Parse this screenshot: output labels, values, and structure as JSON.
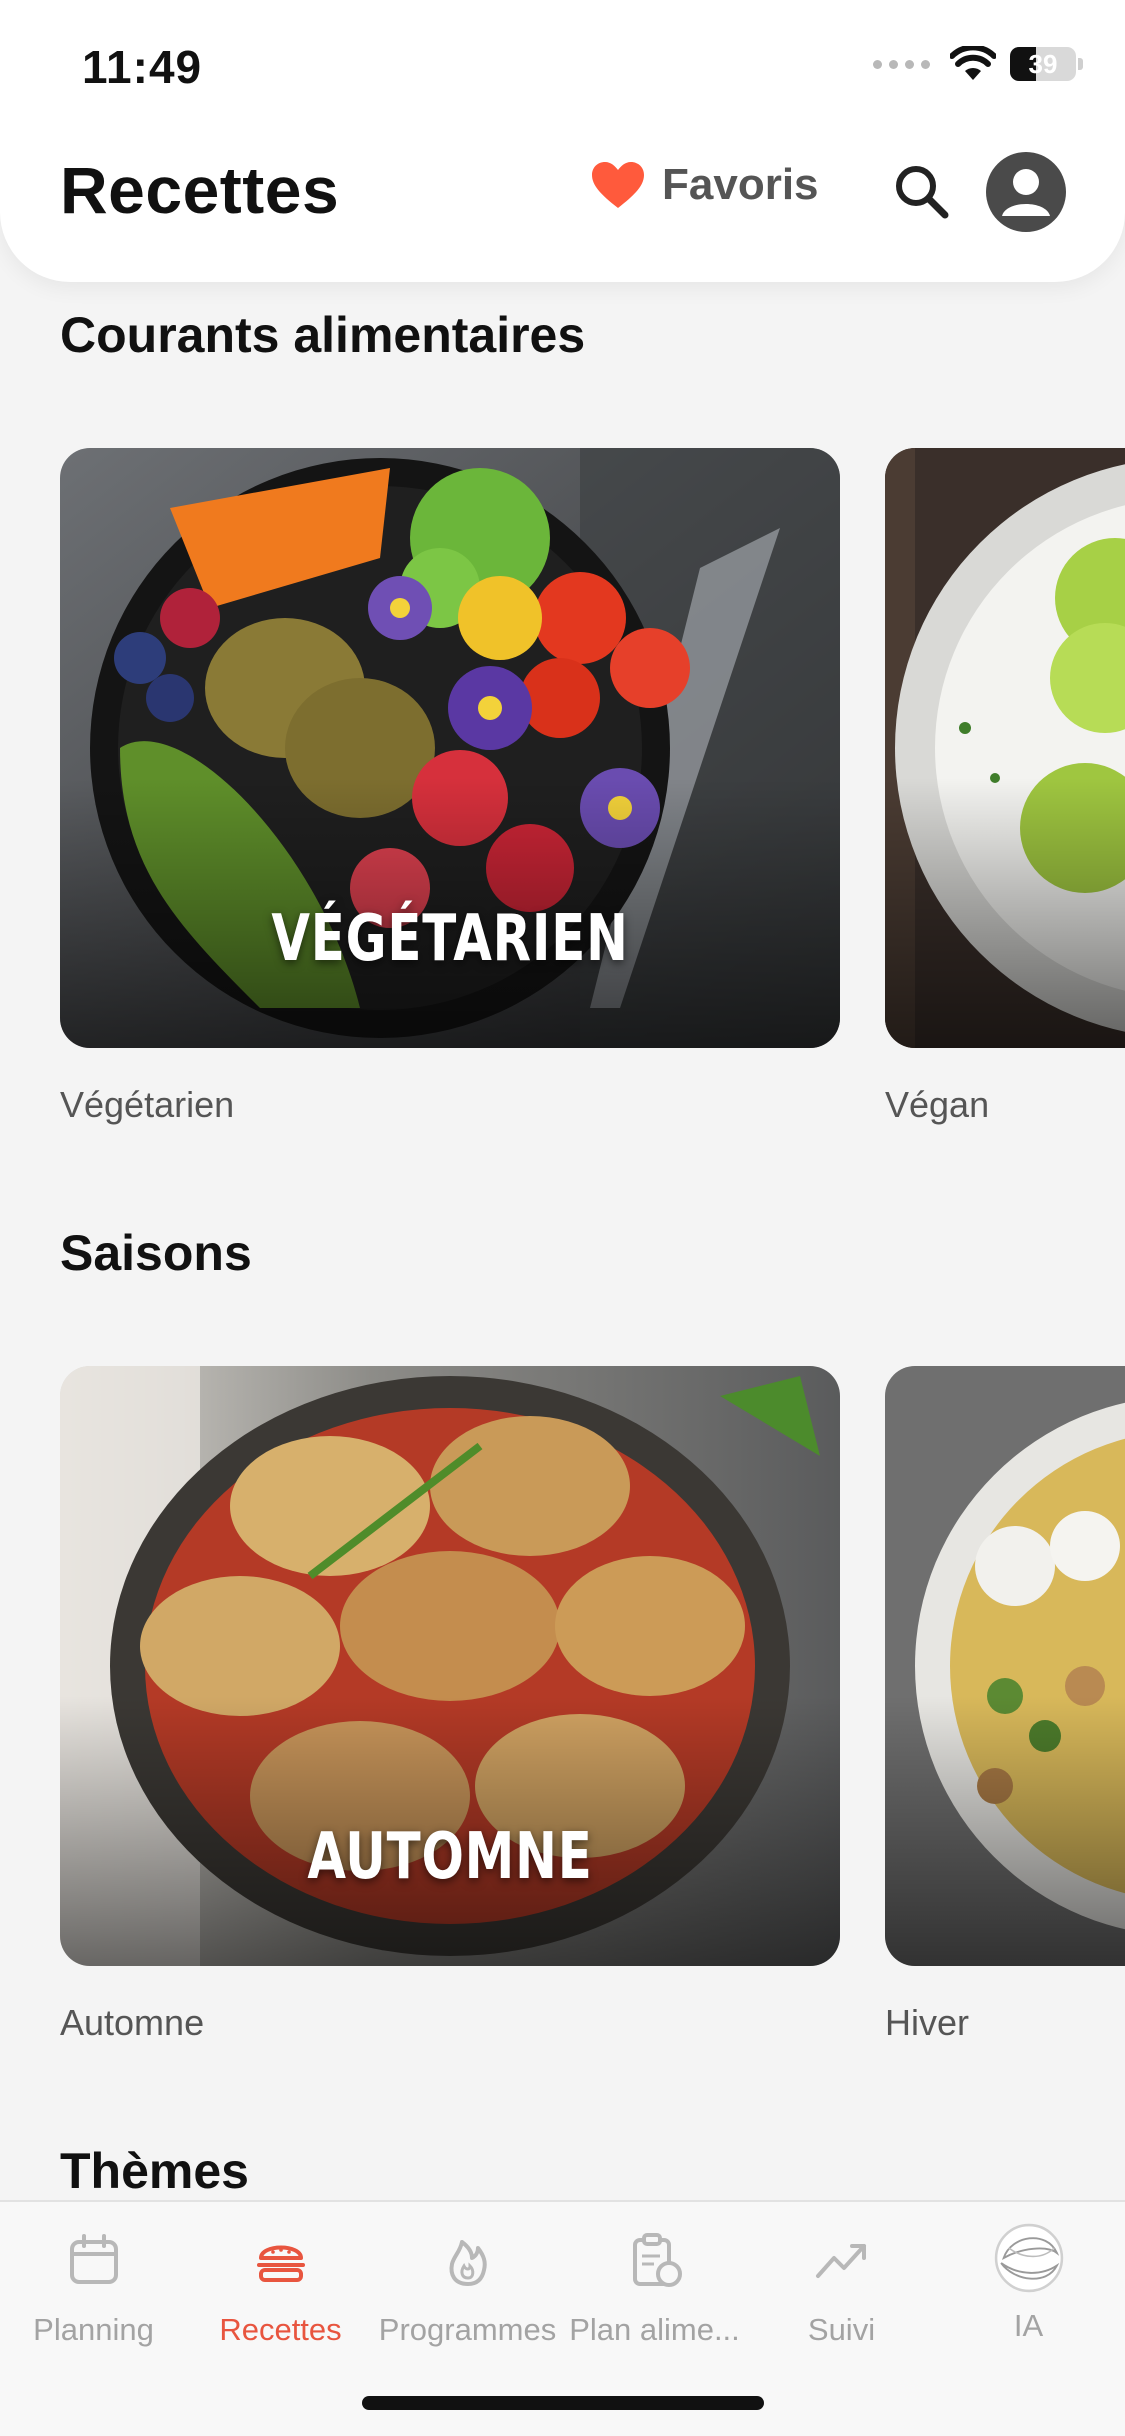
{
  "status_bar": {
    "time": "11:49",
    "battery_percent": 39,
    "battery_label": "39"
  },
  "header": {
    "title": "Recettes",
    "favorites_label": "Favoris",
    "accent_color": "#ff5a3c"
  },
  "sections": [
    {
      "title": "Courants alimentaires",
      "cards": [
        {
          "overlay": "VÉGÉTARIEN",
          "caption": "Végétarien"
        },
        {
          "overlay": "",
          "caption": "Végan"
        }
      ]
    },
    {
      "title": "Saisons",
      "cards": [
        {
          "overlay": "AUTOMNE",
          "caption": "Automne"
        },
        {
          "overlay": "",
          "caption": "Hiver"
        }
      ]
    },
    {
      "title": "Thèmes",
      "cards": []
    }
  ],
  "tabbar": {
    "active_color": "#e8553f",
    "inactive_color": "#a3a3a3",
    "items": [
      {
        "label": "Planning",
        "icon": "calendar-icon",
        "active": false
      },
      {
        "label": "Recettes",
        "icon": "burger-icon",
        "active": true
      },
      {
        "label": "Programmes",
        "icon": "flame-icon",
        "active": false
      },
      {
        "label": "Plan alime...",
        "icon": "clipboard-apple-icon",
        "active": false
      },
      {
        "label": "Suivi",
        "icon": "trend-up-icon",
        "active": false
      },
      {
        "label": "IA",
        "icon": "ai-orb-icon",
        "active": false
      }
    ]
  }
}
